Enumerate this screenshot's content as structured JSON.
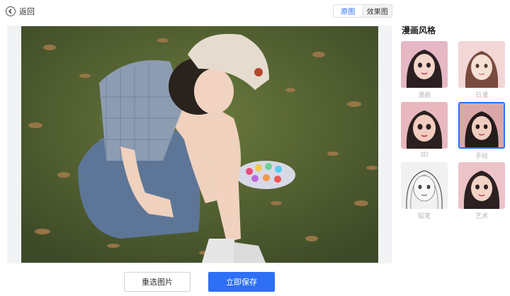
{
  "header": {
    "back_label": "返回",
    "view_toggle": [
      {
        "label": "原图",
        "active": true
      },
      {
        "label": "效果图",
        "active": false
      }
    ]
  },
  "actions": {
    "reselect_label": "重选图片",
    "save_label": "立即保存"
  },
  "style_panel": {
    "title": "漫画风格",
    "selected": "手绘",
    "items": [
      {
        "label": "漫画",
        "bg": "#e6b7c4"
      },
      {
        "label": "日漫",
        "bg": "#f3d7d7"
      },
      {
        "label": "3D",
        "bg": "#e9b8bf"
      },
      {
        "label": "手绘",
        "bg": "#d9a7a8"
      },
      {
        "label": "铅笔",
        "bg": "#f1f1f1"
      },
      {
        "label": "艺术",
        "bg": "#ecc3c8"
      }
    ]
  },
  "colors": {
    "accent": "#2e6ff5"
  }
}
